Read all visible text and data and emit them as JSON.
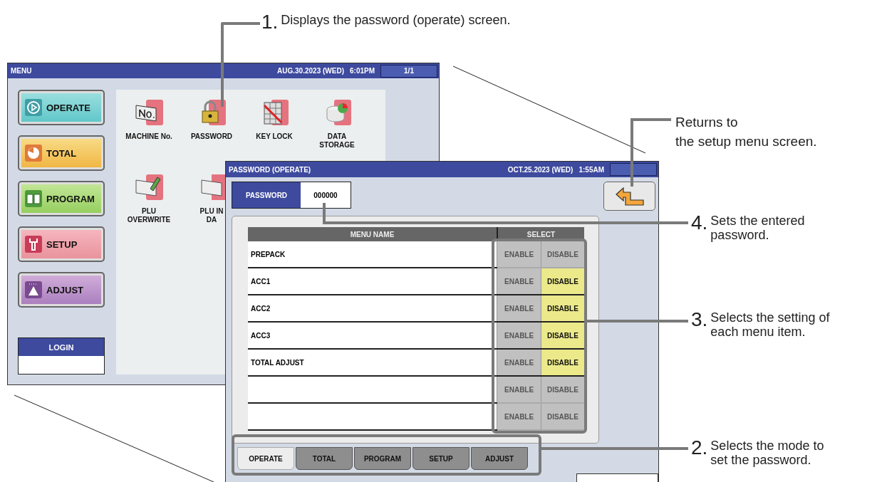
{
  "callouts": [
    {
      "kind": "numbered",
      "number": "1.",
      "lines": [
        "Displays the password (operate) screen."
      ]
    },
    {
      "kind": "plain",
      "lines": [
        "Returns to",
        "the setup menu screen."
      ]
    },
    {
      "kind": "numbered",
      "number": "4.",
      "lines": [
        "Sets the entered",
        "password."
      ]
    },
    {
      "kind": "numbered",
      "number": "3.",
      "lines": [
        "Selects the setting of",
        "each menu item."
      ]
    },
    {
      "kind": "numbered",
      "number": "2.",
      "lines": [
        "Selects the mode to",
        "set the password."
      ]
    }
  ],
  "menu_screen": {
    "title": "MENU",
    "date": "AUG.30.2023 (WED)",
    "time": "6:01PM",
    "page": "1/1",
    "mode_buttons": [
      {
        "kind": "operate",
        "label": "OPERATE"
      },
      {
        "kind": "total",
        "label": "TOTAL"
      },
      {
        "kind": "program",
        "label": "PROGRAM"
      },
      {
        "kind": "setup",
        "label": "SETUP"
      },
      {
        "kind": "adjust",
        "label": "ADJUST"
      }
    ],
    "items": [
      {
        "kind": "number",
        "lines": [
          "MACHINE No."
        ]
      },
      {
        "kind": "lock",
        "lines": [
          "PASSWORD"
        ]
      },
      {
        "kind": "keypad",
        "lines": [
          "KEY LOCK"
        ]
      },
      {
        "kind": "storage",
        "lines": [
          "DATA",
          "STORAGE"
        ]
      },
      {
        "kind": "overwrite",
        "lines": [
          "PLU",
          "OVERWRITE"
        ]
      },
      {
        "kind": "plate",
        "lines": [
          "PLU IN",
          "DA"
        ]
      }
    ],
    "login": {
      "label": "LOGIN"
    }
  },
  "password_screen": {
    "title": "PASSWORD (OPERATE)",
    "date": "OCT.25.2023 (WED)",
    "time": "1:55AM",
    "password": {
      "label": "PASSWORD",
      "value": "000000"
    },
    "columns": [
      "MENU NAME",
      "SELECT"
    ],
    "rows": [
      {
        "name": "PREPACK",
        "disabled": true,
        "options": [
          {
            "label": "ENABLE",
            "selected": false
          },
          {
            "label": "DISABLE",
            "selected": false
          }
        ]
      },
      {
        "name": "ACC1",
        "disabled": false,
        "options": [
          {
            "label": "ENABLE",
            "selected": false
          },
          {
            "label": "DISABLE",
            "selected": true
          }
        ]
      },
      {
        "name": "ACC2",
        "disabled": false,
        "options": [
          {
            "label": "ENABLE",
            "selected": false
          },
          {
            "label": "DISABLE",
            "selected": true
          }
        ]
      },
      {
        "name": "ACC3",
        "disabled": false,
        "options": [
          {
            "label": "ENABLE",
            "selected": false
          },
          {
            "label": "DISABLE",
            "selected": true
          }
        ]
      },
      {
        "name": "TOTAL ADJUST",
        "disabled": false,
        "options": [
          {
            "label": "ENABLE",
            "selected": false
          },
          {
            "label": "DISABLE",
            "selected": true
          }
        ]
      },
      {
        "disabled": true,
        "options": [
          {
            "label": "ENABLE",
            "selected": false
          },
          {
            "label": "DISABLE",
            "selected": false
          }
        ]
      },
      {
        "disabled": true,
        "options": [
          {
            "label": "ENABLE",
            "selected": false
          },
          {
            "label": "DISABLE",
            "selected": false
          }
        ]
      }
    ],
    "tabs": [
      {
        "label": "OPERATE",
        "selected": true
      },
      {
        "label": "TOTAL",
        "selected": false
      },
      {
        "label": "PROGRAM",
        "selected": false
      },
      {
        "label": "SETUP",
        "selected": false
      },
      {
        "label": "ADJUST",
        "selected": false
      }
    ]
  }
}
